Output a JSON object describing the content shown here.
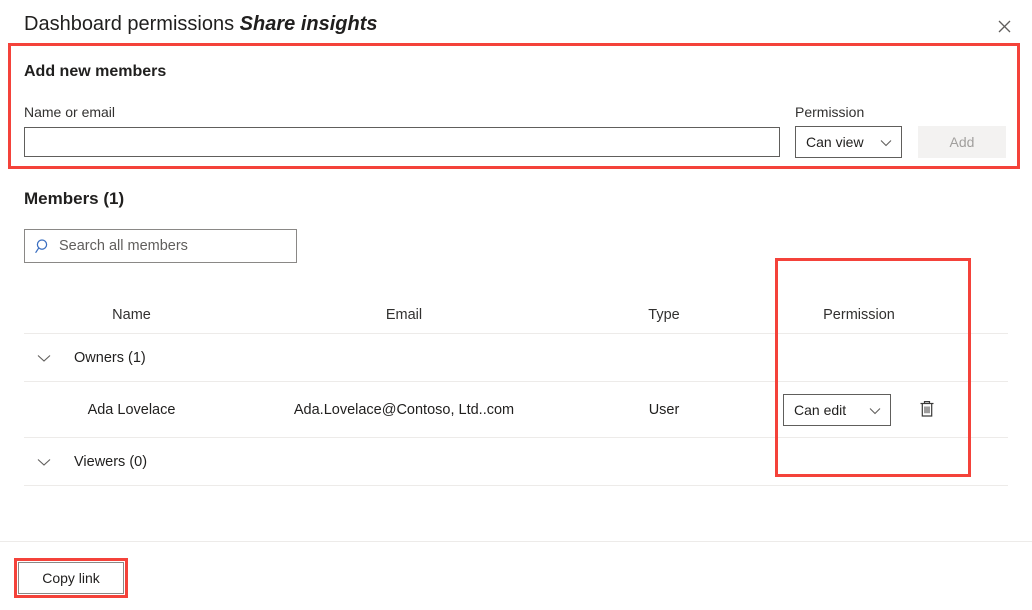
{
  "header": {
    "title_prefix": "Dashboard permissions",
    "subject": "Share insights",
    "close_icon": "close-icon"
  },
  "add_members": {
    "heading": "Add new members",
    "name_or_email_label": "Name or email",
    "name_or_email_value": "",
    "name_or_email_placeholder": "",
    "permission_label": "Permission",
    "permission_value": "Can view",
    "permission_options": [
      "Can view",
      "Can edit"
    ],
    "add_button_label": "Add",
    "add_button_disabled": true,
    "chevron_icon": "chevron-down-icon"
  },
  "members": {
    "heading": "Members (1)",
    "search_placeholder": "Search all members",
    "search_value": "",
    "search_icon": "search-icon",
    "columns": [
      "Name",
      "Email",
      "Type",
      "Permission"
    ],
    "groups": [
      {
        "label": "Owners (1)",
        "expanded": true,
        "chevron_icon": "chevron-down-icon",
        "rows": [
          {
            "name": "Ada Lovelace",
            "email": "Ada.Lovelace@Contoso, Ltd..com",
            "type": "User",
            "permission": "Can edit",
            "permission_options": [
              "Can view",
              "Can edit"
            ],
            "delete_icon": "trash-icon"
          }
        ]
      },
      {
        "label": "Viewers (0)",
        "expanded": true,
        "chevron_icon": "chevron-down-icon",
        "rows": []
      }
    ]
  },
  "footer": {
    "copy_link_label": "Copy link"
  },
  "highlights": {
    "color": "#f4423a",
    "boxes": [
      "add-new-members-section",
      "permission-column",
      "copy-link-button"
    ]
  },
  "colors": {
    "accent": "#0078d4",
    "text": "#201f1e",
    "border": "#605e5c",
    "divider": "#edebe9",
    "disabled_bg": "#f3f2f1",
    "disabled_text": "#a19f9d",
    "highlight": "#f4423a"
  }
}
